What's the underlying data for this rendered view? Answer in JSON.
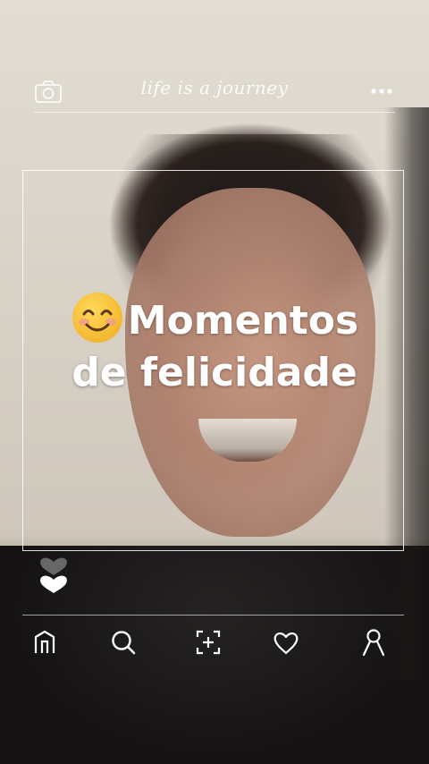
{
  "header": {
    "title": "life is a journey",
    "left_icon": "camera-icon",
    "right_icon": "more-icon"
  },
  "caption": {
    "emoji": "smiling-face-emoji",
    "line1": "Momentos",
    "line2": "de felicidade"
  },
  "reactions": {
    "icon": "heart-icon"
  },
  "bottom_nav": {
    "items": [
      {
        "icon": "home-icon"
      },
      {
        "icon": "search-icon"
      },
      {
        "icon": "add-post-icon"
      },
      {
        "icon": "heart-outline-icon"
      },
      {
        "icon": "profile-icon"
      }
    ]
  },
  "colors": {
    "overlay": "#ffffff",
    "emoji_face": "#f7c23d",
    "emoji_cheeks": "#f29a8b"
  }
}
